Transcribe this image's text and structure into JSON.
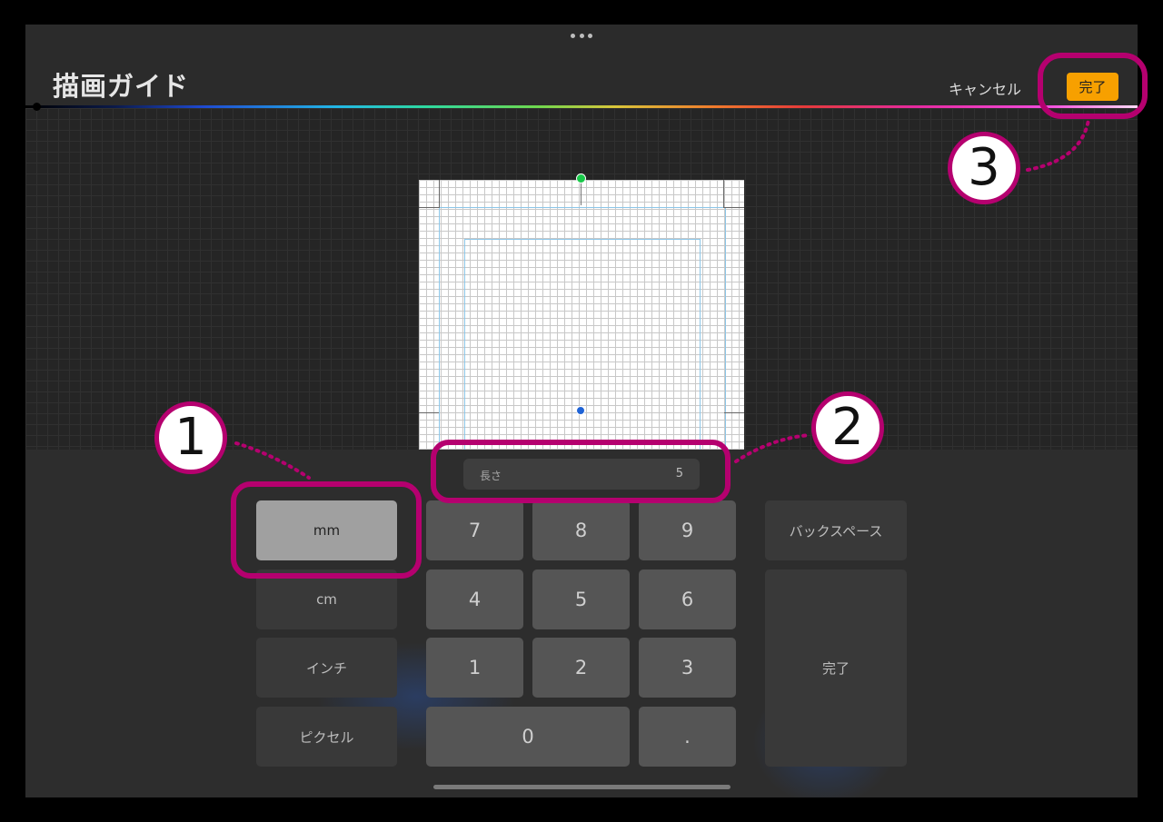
{
  "header": {
    "title": "描画ガイド",
    "cancel_label": "キャンセル",
    "done_label": "完了"
  },
  "length_field": {
    "label": "長さ",
    "value": "5"
  },
  "units": [
    "mm",
    "cm",
    "インチ",
    "ピクセル"
  ],
  "selected_unit": "mm",
  "keys": {
    "seven": "7",
    "eight": "8",
    "nine": "9",
    "four": "4",
    "five": "5",
    "six": "6",
    "one": "1",
    "two": "2",
    "three": "3",
    "zero": "0",
    "dot": "."
  },
  "backspace_label": "バックスペース",
  "keypad_done_label": "完了",
  "callouts": [
    "1",
    "2",
    "3"
  ],
  "colors": {
    "accent": "#f7a000",
    "callout": "#b5006f"
  },
  "icons": [
    "more-dots-icon",
    "green-handle-icon",
    "blue-handle-icon"
  ]
}
